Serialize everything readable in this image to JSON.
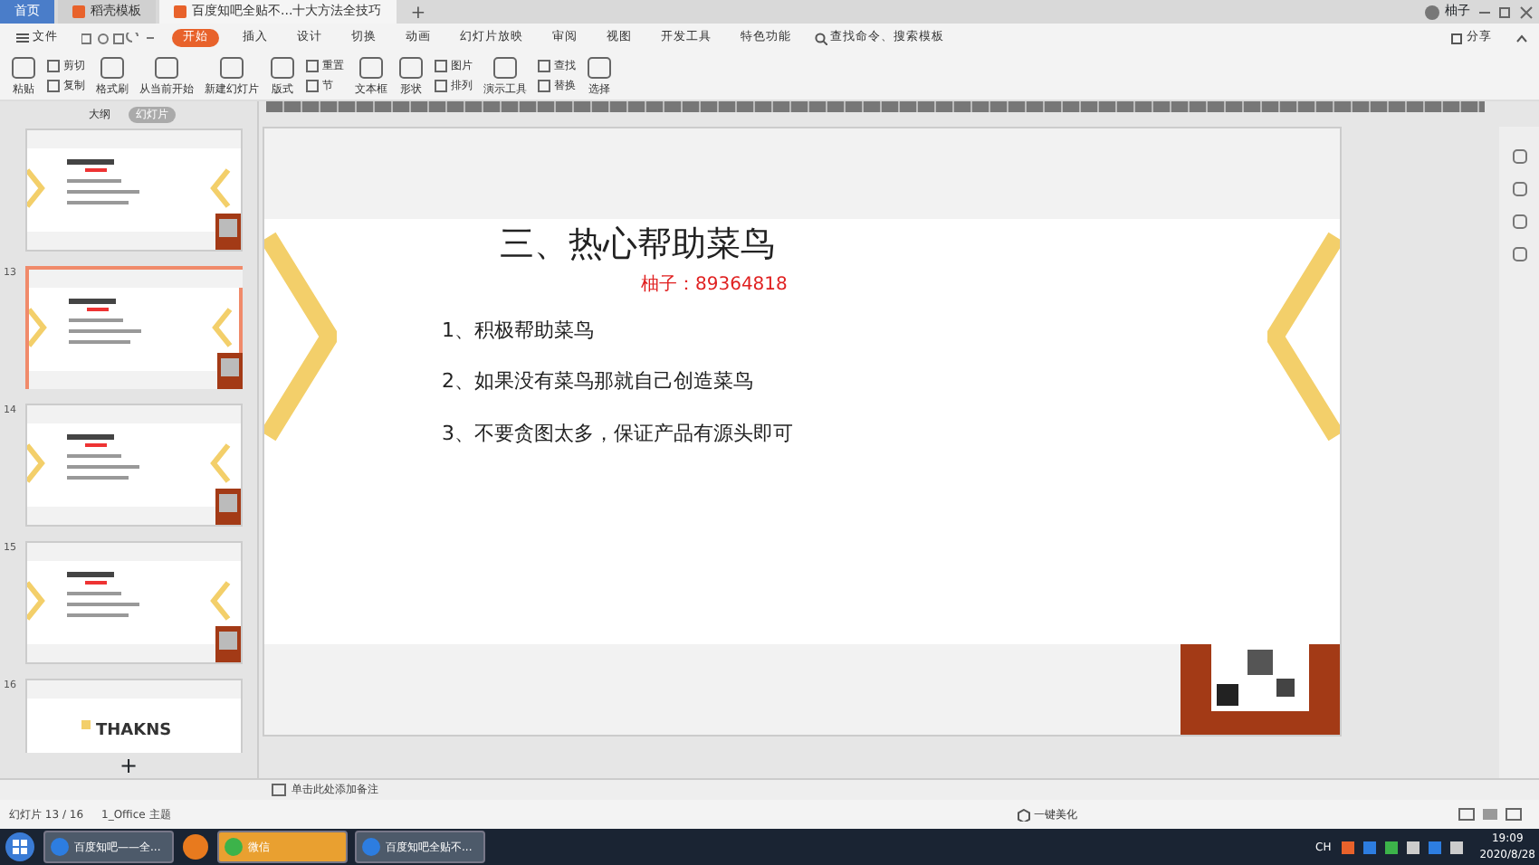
{
  "tabs": [
    {
      "label": "首页",
      "selected": false
    },
    {
      "label": "稻壳模板",
      "selected": false
    },
    {
      "label": "百度知吧全贴不...十大方法全技巧",
      "selected": true
    }
  ],
  "new_tab": "+",
  "user": "柚子",
  "menu": {
    "file": "文件",
    "items": [
      {
        "label": "开始",
        "selected": true
      },
      {
        "label": "插入",
        "selected": false
      },
      {
        "label": "设计",
        "selected": false
      },
      {
        "label": "切换",
        "selected": false
      },
      {
        "label": "动画",
        "selected": false
      },
      {
        "label": "幻灯片放映",
        "selected": false
      },
      {
        "label": "审阅",
        "selected": false
      },
      {
        "label": "视图",
        "selected": false
      },
      {
        "label": "开发工具",
        "selected": false
      },
      {
        "label": "特色功能",
        "selected": false
      }
    ],
    "search": "查找命令、搜索模板",
    "share": "分享"
  },
  "ribbon": [
    {
      "label": "粘贴",
      "kind": "large"
    },
    {
      "label": "剪切",
      "kind": "small"
    },
    {
      "label": "复制",
      "kind": "small"
    },
    {
      "label": "格式刷",
      "kind": "large"
    },
    {
      "label": "从当前开始",
      "kind": "large"
    },
    {
      "label": "新建幻灯片",
      "kind": "large"
    },
    {
      "label": "版式",
      "kind": "large"
    },
    {
      "label": "重置",
      "kind": "small"
    },
    {
      "label": "节",
      "kind": "small"
    },
    {
      "label": "文本框",
      "kind": "large"
    },
    {
      "label": "形状",
      "kind": "large"
    },
    {
      "label": "图片",
      "kind": "small"
    },
    {
      "label": "排列",
      "kind": "small"
    },
    {
      "label": "演示工具",
      "kind": "large"
    },
    {
      "label": "查找",
      "kind": "small"
    },
    {
      "label": "替换",
      "kind": "small"
    },
    {
      "label": "选择",
      "kind": "large"
    }
  ],
  "panel": {
    "tabs": [
      {
        "label": "大纲",
        "selected": false
      },
      {
        "label": "幻灯片",
        "selected": true
      }
    ],
    "add_slide": "+",
    "slides": [
      {
        "selected": false
      },
      {
        "number": "13",
        "selected": true
      },
      {
        "number": "14",
        "selected": false
      },
      {
        "number": "15",
        "selected": false
      },
      {
        "number": "16",
        "selected": false,
        "title": "THAKNS"
      }
    ]
  },
  "slide": {
    "title": "三、热心帮助菜鸟",
    "note": "柚子：89364818",
    "items": [
      "1、积极帮助菜鸟",
      "2、如果没有菜鸟那就自己创造菜鸟",
      "3、不要贪图太多，保证产品有源头即可"
    ]
  },
  "notes": {
    "placeholder": "单击此处添加备注"
  },
  "status": {
    "slide_count": "幻灯片 13 / 16",
    "theme": "1_Office 主题",
    "beautify": "一键美化"
  },
  "taskbar": {
    "items": [
      {
        "label": "百度知吧——全..."
      },
      {
        "label": "微信"
      },
      {
        "label": "百度知吧全贴不..."
      }
    ],
    "lang": "CH",
    "time": "19:09",
    "date": "2020/8/28"
  }
}
